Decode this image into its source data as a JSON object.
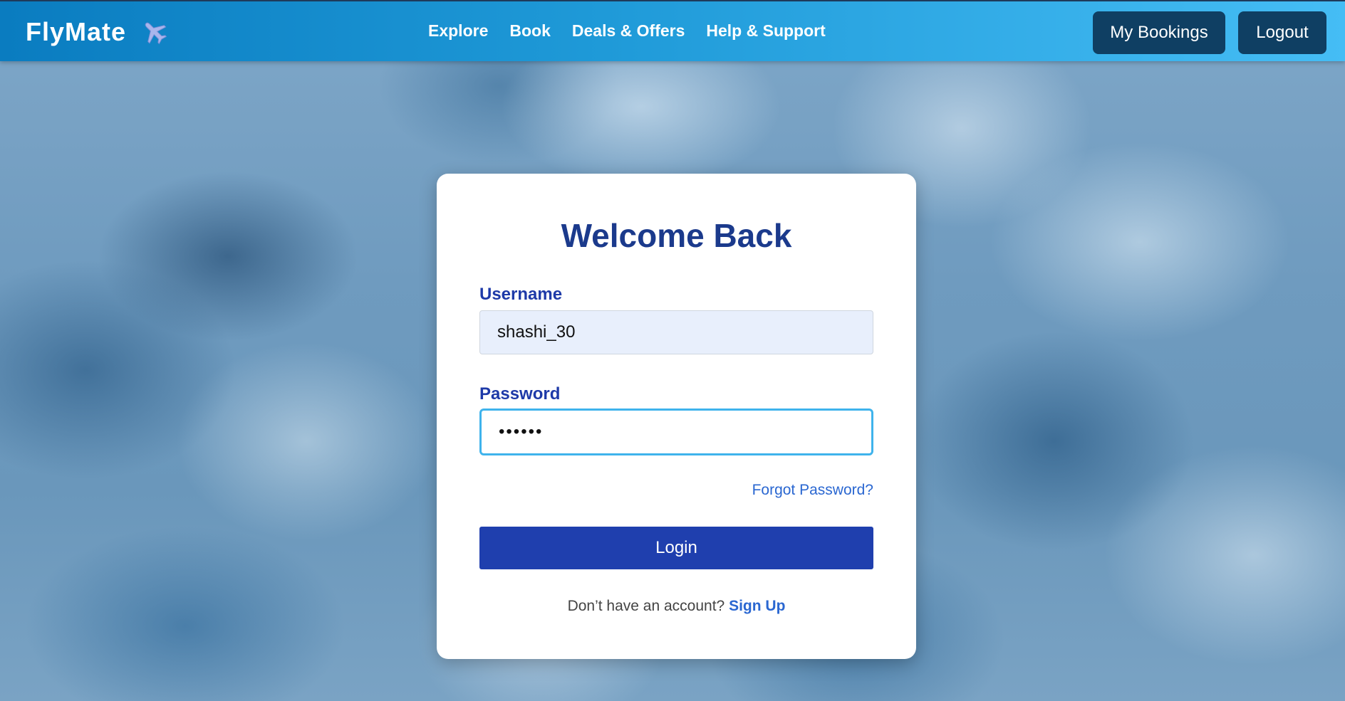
{
  "brand": {
    "name": "FlyMate",
    "icon": "airplane-icon"
  },
  "nav": {
    "items": [
      {
        "label": "Explore"
      },
      {
        "label": "Book"
      },
      {
        "label": "Deals & Offers"
      },
      {
        "label": "Help & Support"
      }
    ]
  },
  "header_buttons": {
    "bookings_label": "My Bookings",
    "logout_label": "Logout"
  },
  "login": {
    "title": "Welcome Back",
    "username_label": "Username",
    "username_value": "shashi_30",
    "password_label": "Password",
    "password_value": "••••••",
    "forgot_label": "Forgot Password?",
    "submit_label": "Login",
    "signup_prompt": "Don’t have an account?",
    "signup_label": "Sign Up"
  },
  "colors": {
    "header_start": "#0a7cc0",
    "header_end": "#45bdf5",
    "header_button": "#0f3f63",
    "title": "#1b3a8c",
    "primary_button": "#1f3fae",
    "link": "#2a67d1",
    "focus_border": "#3fb3ec"
  }
}
